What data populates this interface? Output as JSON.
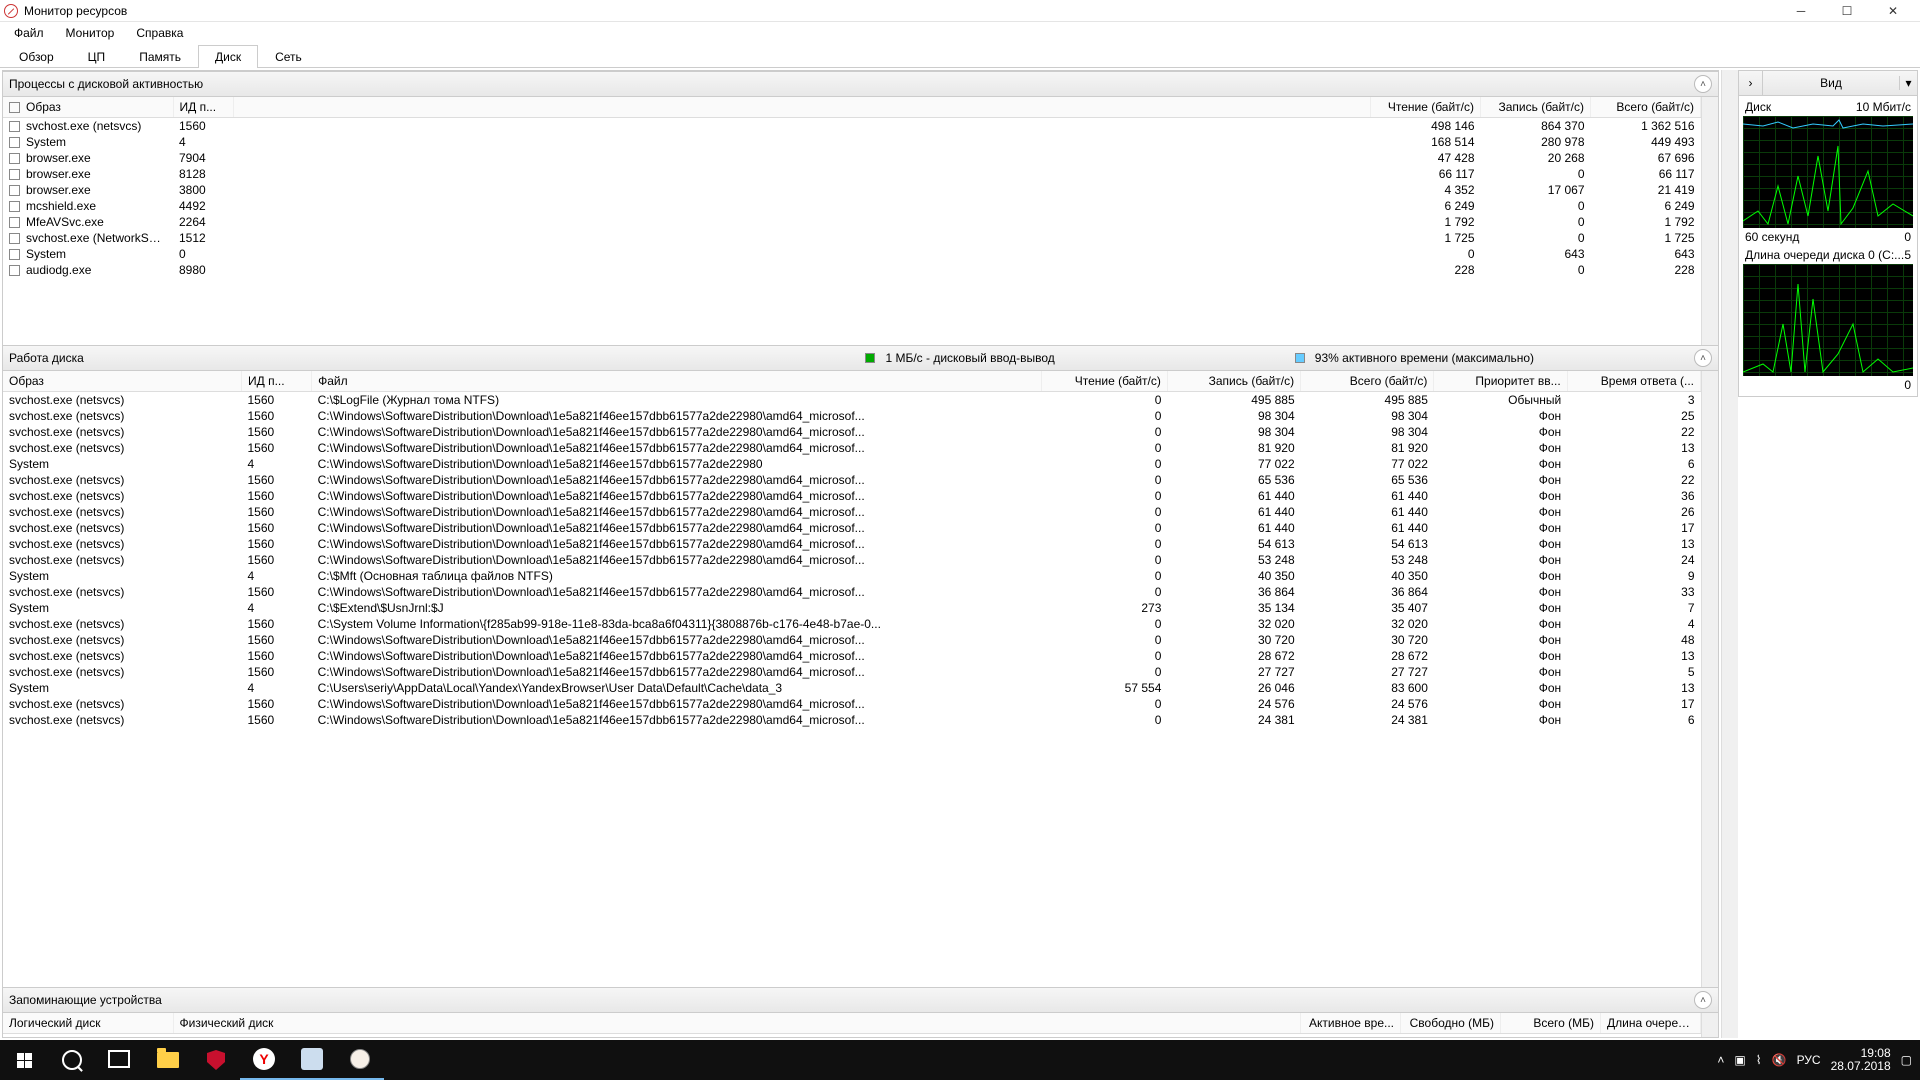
{
  "window": {
    "title": "Монитор ресурсов"
  },
  "menu": {
    "file": "Файл",
    "monitor": "Монитор",
    "help": "Справка"
  },
  "tabs": {
    "overview": "Обзор",
    "cpu": "ЦП",
    "memory": "Память",
    "disk": "Диск",
    "network": "Сеть",
    "active": "disk"
  },
  "section_processes": {
    "title": "Процессы с дисковой активностью",
    "cols": {
      "image": "Образ",
      "pid": "ИД п...",
      "read": "Чтение (байт/с)",
      "write": "Запись (байт/с)",
      "total": "Всего (байт/с)"
    },
    "rows": [
      {
        "image": "svchost.exe (netsvcs)",
        "pid": "1560",
        "read": "498 146",
        "write": "864 370",
        "total": "1 362 516"
      },
      {
        "image": "System",
        "pid": "4",
        "read": "168 514",
        "write": "280 978",
        "total": "449 493"
      },
      {
        "image": "browser.exe",
        "pid": "7904",
        "read": "47 428",
        "write": "20 268",
        "total": "67 696"
      },
      {
        "image": "browser.exe",
        "pid": "8128",
        "read": "66 117",
        "write": "0",
        "total": "66 117"
      },
      {
        "image": "browser.exe",
        "pid": "3800",
        "read": "4 352",
        "write": "17 067",
        "total": "21 419"
      },
      {
        "image": "mcshield.exe",
        "pid": "4492",
        "read": "6 249",
        "write": "0",
        "total": "6 249"
      },
      {
        "image": "MfeAVSvc.exe",
        "pid": "2264",
        "read": "1 792",
        "write": "0",
        "total": "1 792"
      },
      {
        "image": "svchost.exe (NetworkService)",
        "pid": "1512",
        "read": "1 725",
        "write": "0",
        "total": "1 725"
      },
      {
        "image": "System",
        "pid": "0",
        "read": "0",
        "write": "643",
        "total": "643"
      },
      {
        "image": "audiodg.exe",
        "pid": "8980",
        "read": "228",
        "write": "0",
        "total": "228"
      }
    ]
  },
  "section_activity": {
    "title": "Работа диска",
    "legend_io": "1 МБ/с - дисковый ввод-вывод",
    "legend_active": "93% активного времени (максимально)",
    "cols": {
      "image": "Образ",
      "pid": "ИД п...",
      "file": "Файл",
      "read": "Чтение (байт/с)",
      "write": "Запись (байт/с)",
      "total": "Всего (байт/с)",
      "prio": "Приоритет вв...",
      "resp": "Время ответа (..."
    },
    "rows": [
      {
        "image": "svchost.exe (netsvcs)",
        "pid": "1560",
        "file": "C:\\$LogFile (Журнал тома NTFS)",
        "read": "0",
        "write": "495 885",
        "total": "495 885",
        "prio": "Обычный",
        "resp": "3"
      },
      {
        "image": "svchost.exe (netsvcs)",
        "pid": "1560",
        "file": "C:\\Windows\\SoftwareDistribution\\Download\\1e5a821f46ee157dbb61577a2de22980\\amd64_microsof...",
        "read": "0",
        "write": "98 304",
        "total": "98 304",
        "prio": "Фон",
        "resp": "25"
      },
      {
        "image": "svchost.exe (netsvcs)",
        "pid": "1560",
        "file": "C:\\Windows\\SoftwareDistribution\\Download\\1e5a821f46ee157dbb61577a2de22980\\amd64_microsof...",
        "read": "0",
        "write": "98 304",
        "total": "98 304",
        "prio": "Фон",
        "resp": "22"
      },
      {
        "image": "svchost.exe (netsvcs)",
        "pid": "1560",
        "file": "C:\\Windows\\SoftwareDistribution\\Download\\1e5a821f46ee157dbb61577a2de22980\\amd64_microsof...",
        "read": "0",
        "write": "81 920",
        "total": "81 920",
        "prio": "Фон",
        "resp": "13"
      },
      {
        "image": "System",
        "pid": "4",
        "file": "C:\\Windows\\SoftwareDistribution\\Download\\1e5a821f46ee157dbb61577a2de22980",
        "read": "0",
        "write": "77 022",
        "total": "77 022",
        "prio": "Фон",
        "resp": "6"
      },
      {
        "image": "svchost.exe (netsvcs)",
        "pid": "1560",
        "file": "C:\\Windows\\SoftwareDistribution\\Download\\1e5a821f46ee157dbb61577a2de22980\\amd64_microsof...",
        "read": "0",
        "write": "65 536",
        "total": "65 536",
        "prio": "Фон",
        "resp": "22"
      },
      {
        "image": "svchost.exe (netsvcs)",
        "pid": "1560",
        "file": "C:\\Windows\\SoftwareDistribution\\Download\\1e5a821f46ee157dbb61577a2de22980\\amd64_microsof...",
        "read": "0",
        "write": "61 440",
        "total": "61 440",
        "prio": "Фон",
        "resp": "36"
      },
      {
        "image": "svchost.exe (netsvcs)",
        "pid": "1560",
        "file": "C:\\Windows\\SoftwareDistribution\\Download\\1e5a821f46ee157dbb61577a2de22980\\amd64_microsof...",
        "read": "0",
        "write": "61 440",
        "total": "61 440",
        "prio": "Фон",
        "resp": "26"
      },
      {
        "image": "svchost.exe (netsvcs)",
        "pid": "1560",
        "file": "C:\\Windows\\SoftwareDistribution\\Download\\1e5a821f46ee157dbb61577a2de22980\\amd64_microsof...",
        "read": "0",
        "write": "61 440",
        "total": "61 440",
        "prio": "Фон",
        "resp": "17"
      },
      {
        "image": "svchost.exe (netsvcs)",
        "pid": "1560",
        "file": "C:\\Windows\\SoftwareDistribution\\Download\\1e5a821f46ee157dbb61577a2de22980\\amd64_microsof...",
        "read": "0",
        "write": "54 613",
        "total": "54 613",
        "prio": "Фон",
        "resp": "13"
      },
      {
        "image": "svchost.exe (netsvcs)",
        "pid": "1560",
        "file": "C:\\Windows\\SoftwareDistribution\\Download\\1e5a821f46ee157dbb61577a2de22980\\amd64_microsof...",
        "read": "0",
        "write": "53 248",
        "total": "53 248",
        "prio": "Фон",
        "resp": "24"
      },
      {
        "image": "System",
        "pid": "4",
        "file": "C:\\$Mft (Основная таблица файлов NTFS)",
        "read": "0",
        "write": "40 350",
        "total": "40 350",
        "prio": "Фон",
        "resp": "9"
      },
      {
        "image": "svchost.exe (netsvcs)",
        "pid": "1560",
        "file": "C:\\Windows\\SoftwareDistribution\\Download\\1e5a821f46ee157dbb61577a2de22980\\amd64_microsof...",
        "read": "0",
        "write": "36 864",
        "total": "36 864",
        "prio": "Фон",
        "resp": "33"
      },
      {
        "image": "System",
        "pid": "4",
        "file": "C:\\$Extend\\$UsnJrnl:$J",
        "read": "273",
        "write": "35 134",
        "total": "35 407",
        "prio": "Фон",
        "resp": "7"
      },
      {
        "image": "svchost.exe (netsvcs)",
        "pid": "1560",
        "file": "C:\\System Volume Information\\{f285ab99-918e-11e8-83da-bca8a6f04311}{3808876b-c176-4e48-b7ae-0...",
        "read": "0",
        "write": "32 020",
        "total": "32 020",
        "prio": "Фон",
        "resp": "4"
      },
      {
        "image": "svchost.exe (netsvcs)",
        "pid": "1560",
        "file": "C:\\Windows\\SoftwareDistribution\\Download\\1e5a821f46ee157dbb61577a2de22980\\amd64_microsof...",
        "read": "0",
        "write": "30 720",
        "total": "30 720",
        "prio": "Фон",
        "resp": "48"
      },
      {
        "image": "svchost.exe (netsvcs)",
        "pid": "1560",
        "file": "C:\\Windows\\SoftwareDistribution\\Download\\1e5a821f46ee157dbb61577a2de22980\\amd64_microsof...",
        "read": "0",
        "write": "28 672",
        "total": "28 672",
        "prio": "Фон",
        "resp": "13"
      },
      {
        "image": "svchost.exe (netsvcs)",
        "pid": "1560",
        "file": "C:\\Windows\\SoftwareDistribution\\Download\\1e5a821f46ee157dbb61577a2de22980\\amd64_microsof...",
        "read": "0",
        "write": "27 727",
        "total": "27 727",
        "prio": "Фон",
        "resp": "5"
      },
      {
        "image": "System",
        "pid": "4",
        "file": "C:\\Users\\seriy\\AppData\\Local\\Yandex\\YandexBrowser\\User Data\\Default\\Cache\\data_3",
        "read": "57 554",
        "write": "26 046",
        "total": "83 600",
        "prio": "Фон",
        "resp": "13"
      },
      {
        "image": "svchost.exe (netsvcs)",
        "pid": "1560",
        "file": "C:\\Windows\\SoftwareDistribution\\Download\\1e5a821f46ee157dbb61577a2de22980\\amd64_microsof...",
        "read": "0",
        "write": "24 576",
        "total": "24 576",
        "prio": "Фон",
        "resp": "17"
      },
      {
        "image": "svchost.exe (netsvcs)",
        "pid": "1560",
        "file": "C:\\Windows\\SoftwareDistribution\\Download\\1e5a821f46ee157dbb61577a2de22980\\amd64_microsof...",
        "read": "0",
        "write": "24 381",
        "total": "24 381",
        "prio": "Фон",
        "resp": "6"
      }
    ]
  },
  "section_storage": {
    "title": "Запоминающие устройства",
    "cols": {
      "logical": "Логический диск",
      "physical": "Физический диск",
      "active": "Активное вре...",
      "free": "Свободно (МБ)",
      "total": "Всего (МБ)",
      "queue": "Длина очеред..."
    }
  },
  "side": {
    "view_label": "Вид",
    "chart1": {
      "title": "Диск",
      "scale": "10 Мбит/с",
      "footer_left": "60 секунд",
      "footer_right": "0"
    },
    "chart2": {
      "title": "Длина очереди диска 0 (C:...",
      "scale": "5",
      "footer_right": "0"
    }
  },
  "taskbar": {
    "lang": "РУС",
    "time": "19:08",
    "date": "28.07.2018"
  }
}
